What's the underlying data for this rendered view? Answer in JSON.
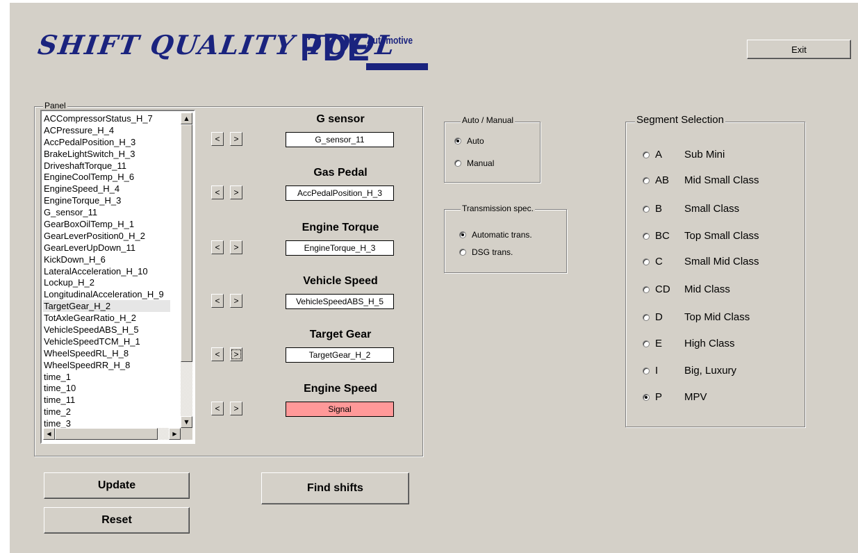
{
  "header": {
    "logo_script": "SHIFT QUALITY TOOL",
    "logo_brand": "PDE",
    "logo_sub": "Automotive",
    "exit_label": "Exit"
  },
  "panel": {
    "label": "Panel",
    "signals": [
      "ACCompressorStatus_H_7",
      "ACPressure_H_4",
      "AccPedalPosition_H_3",
      "BrakeLightSwitch_H_3",
      "DriveshaftTorque_11",
      "EngineCoolTemp_H_6",
      "EngineSpeed_H_4",
      "EngineTorque_H_3",
      "G_sensor_11",
      "GearBoxOilTemp_H_1",
      "GearLeverPosition0_H_2",
      "GearLeverUpDown_11",
      "KickDown_H_6",
      "LateralAcceleration_H_10",
      "Lockup_H_2",
      "LongitudinalAcceleration_H_9",
      "TargetGear_H_2",
      "TotAxleGearRatio_H_2",
      "VehicleSpeedABS_H_5",
      "VehicleSpeedTCM_H_1",
      "WheelSpeedRL_H_8",
      "WheelSpeedRR_H_8",
      "time_1",
      "time_10",
      "time_11",
      "time_2",
      "time_3"
    ],
    "selected_signal": "TargetGear_H_2",
    "prev_label": "<",
    "next_label": ">",
    "mappings": [
      {
        "title": "G sensor",
        "value": "G_sensor_11"
      },
      {
        "title": "Gas Pedal",
        "value": "AccPedalPosition_H_3"
      },
      {
        "title": "Engine Torque",
        "value": "EngineTorque_H_3"
      },
      {
        "title": "Vehicle Speed",
        "value": "VehicleSpeedABS_H_5"
      },
      {
        "title": "Target Gear",
        "value": "TargetGear_H_2"
      },
      {
        "title": "Engine Speed",
        "value": "Signal"
      }
    ],
    "unassigned_color": "#ff9999"
  },
  "auto_manual": {
    "label": "Auto / Manual",
    "options": [
      "Auto",
      "Manual"
    ],
    "selected": "Auto"
  },
  "transmission": {
    "label": "Transmission spec.",
    "options": [
      "Automatic trans.",
      "DSG trans."
    ],
    "selected": "Automatic trans."
  },
  "segment": {
    "label": "Segment Selection",
    "options": [
      {
        "code": "A",
        "name": "Sub Mini"
      },
      {
        "code": "AB",
        "name": "Mid Small Class"
      },
      {
        "code": "B",
        "name": "Small Class"
      },
      {
        "code": "BC",
        "name": "Top Small Class"
      },
      {
        "code": "C",
        "name": "Small Mid Class"
      },
      {
        "code": "CD",
        "name": "Mid Class"
      },
      {
        "code": "D",
        "name": "Top Mid Class"
      },
      {
        "code": "E",
        "name": "High Class"
      },
      {
        "code": "I",
        "name": "Big, Luxury"
      },
      {
        "code": "P",
        "name": "MPV"
      }
    ],
    "selected": "P"
  },
  "actions": {
    "update_label": "Update",
    "reset_label": "Reset",
    "find_shifts_label": "Find shifts"
  },
  "colors": {
    "brand": "#1a237e",
    "background": "#d4d0c8"
  }
}
